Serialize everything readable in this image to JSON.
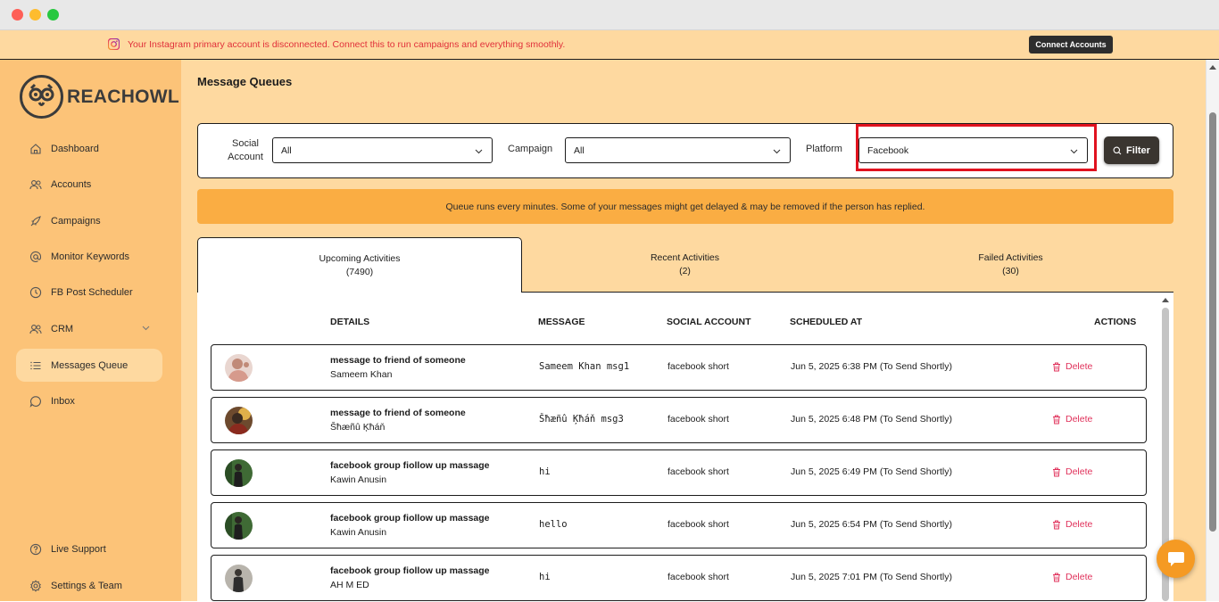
{
  "banner": {
    "message": "Your Instagram primary account is disconnected. Connect this to run campaigns and everything smoothly.",
    "connect_label": "Connect Accounts"
  },
  "brand": {
    "name": "REACHOWL"
  },
  "sidebar": {
    "items": [
      {
        "label": "Dashboard",
        "icon": "home-icon"
      },
      {
        "label": "Accounts",
        "icon": "users-icon"
      },
      {
        "label": "Campaigns",
        "icon": "rocket-icon"
      },
      {
        "label": "Monitor Keywords",
        "icon": "at-icon"
      },
      {
        "label": "FB Post Scheduler",
        "icon": "clock-icon"
      },
      {
        "label": "CRM",
        "icon": "users-icon"
      },
      {
        "label": "Messages Queue",
        "icon": "list-icon",
        "active": true
      },
      {
        "label": "Inbox",
        "icon": "chat-icon"
      }
    ],
    "bottom": [
      {
        "label": "Live Support",
        "icon": "help-icon"
      },
      {
        "label": "Settings & Team",
        "icon": "gear-icon"
      }
    ]
  },
  "page": {
    "title": "Message Queues"
  },
  "filters": {
    "social_account_label": "Social Account",
    "social_account_value": "All",
    "campaign_label": "Campaign",
    "campaign_value": "All",
    "platform_label": "Platform",
    "platform_value": "Facebook",
    "filter_button": "Filter"
  },
  "notice": "Queue runs every minutes. Some of your messages might get delayed & may be removed if the person has replied.",
  "tabs": [
    {
      "label": "Upcoming Activities",
      "count": "(7490)",
      "active": true
    },
    {
      "label": "Recent Activities",
      "count": "(2)"
    },
    {
      "label": "Failed Activities",
      "count": "(30)"
    }
  ],
  "table": {
    "headers": {
      "details": "DETAILS",
      "message": "MESSAGE",
      "social_account": "SOCIAL ACCOUNT",
      "scheduled_at": "SCHEDULED AT",
      "actions": "ACTIONS"
    },
    "delete_label": "Delete",
    "rows": [
      {
        "title": "message to friend of someone",
        "name": "Sameem Khan",
        "message": "Sameem Khan msg1",
        "account": "facebook short",
        "scheduled": "Jun 5, 2025 6:38 PM (To Send Shortly)"
      },
      {
        "title": "message to friend of someone",
        "name": "Šħæñû Ķħáň",
        "message": "Šħæñû Ķħáň msg3",
        "account": "facebook short",
        "scheduled": "Jun 5, 2025 6:48 PM (To Send Shortly)"
      },
      {
        "title": "facebook group fiollow up massage",
        "name": "Kawin Anusin",
        "message": "hi",
        "account": "facebook short",
        "scheduled": "Jun 5, 2025 6:49 PM (To Send Shortly)"
      },
      {
        "title": "facebook group fiollow up massage",
        "name": "Kawin Anusin",
        "message": "hello",
        "account": "facebook short",
        "scheduled": "Jun 5, 2025 6:54 PM (To Send Shortly)"
      },
      {
        "title": "facebook group fiollow up massage",
        "name": "AH M ED",
        "message": "hi",
        "account": "facebook short",
        "scheduled": "Jun 5, 2025 7:01 PM (To Send Shortly)"
      }
    ]
  },
  "colors": {
    "accent": "#fcc378",
    "banner_bg": "#fed9a0",
    "notice_bg": "#faad43",
    "danger": "#e0305a",
    "highlight": "#e0121f"
  }
}
